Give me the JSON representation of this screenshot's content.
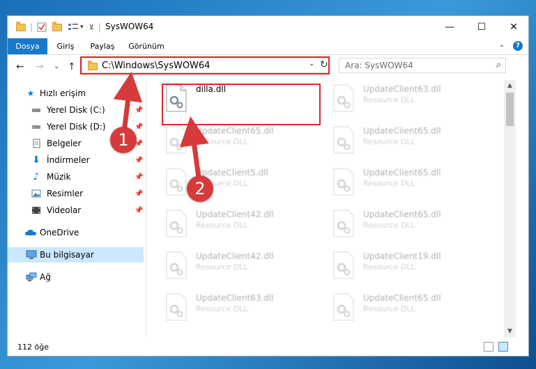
{
  "window": {
    "title": "SysWOW64",
    "minimize_glyph": "—",
    "maximize_glyph": "☐",
    "close_glyph": "✕"
  },
  "ribbon": {
    "tabs": [
      "Dosya",
      "Giriş",
      "Paylaş",
      "Görünüm"
    ],
    "active_tab": "Dosya",
    "help_glyph": "?",
    "accent_color": "#1979ca"
  },
  "address": {
    "path": "C:\\Windows\\SysWOW64",
    "dropdown_glyph": "⌄",
    "refresh_glyph": "↻"
  },
  "search": {
    "placeholder": "Ara: SysWOW64"
  },
  "nav": {
    "back_glyph": "←",
    "forward_glyph": "→",
    "recent_glyph": "⌄",
    "up_glyph": "↑",
    "items": [
      {
        "label": "Hızlı erişim",
        "icon": "star-icon",
        "pinned": false
      },
      {
        "label": "Yerel Disk (C:)",
        "icon": "drive-icon",
        "pinned": true
      },
      {
        "label": "Yerel Disk (D:)",
        "icon": "drive-icon",
        "pinned": true
      },
      {
        "label": "Belgeler",
        "icon": "document-icon",
        "pinned": true
      },
      {
        "label": "İndirmeler",
        "icon": "download-icon",
        "pinned": true
      },
      {
        "label": "Müzik",
        "icon": "music-icon",
        "pinned": true
      },
      {
        "label": "Resimler",
        "icon": "pictures-icon",
        "pinned": true
      },
      {
        "label": "Videolar",
        "icon": "video-icon",
        "pinned": true
      },
      {
        "label": "OneDrive",
        "icon": "cloud-icon",
        "pinned": false
      },
      {
        "label": "Bu bilgisayar",
        "icon": "computer-icon",
        "pinned": false,
        "selected": true
      },
      {
        "label": "Ağ",
        "icon": "network-icon",
        "pinned": false
      }
    ]
  },
  "files": {
    "highlighted": {
      "name": "dilla.dll"
    },
    "left_column": [
      {
        "name": "UpdateClient65.dll",
        "type": "Resource DLL"
      },
      {
        "name": "UpdateClient5.dll",
        "type": "Resource DLL"
      },
      {
        "name": "UpdateClient42.dll",
        "type": "Resource DLL"
      },
      {
        "name": "UpdateClient42.dll",
        "type": "Resource DLL"
      },
      {
        "name": "UpdateClient63.dll",
        "type": "Resource DLL"
      }
    ],
    "right_column": [
      {
        "name": "UpdateClient63.dll",
        "type": "Resource DLL"
      },
      {
        "name": "UpdateClient65.dll",
        "type": "Resource DLL"
      },
      {
        "name": "UpdateClient65.dll",
        "type": "Resource DLL"
      },
      {
        "name": "UpdateClient65.dll",
        "type": "Resource DLL"
      },
      {
        "name": "UpdateClient19.dll",
        "type": "Resource DLL"
      },
      {
        "name": "UpdateClient65.dll",
        "type": "Resource DLL"
      }
    ]
  },
  "status": {
    "item_count": "112 öğe"
  },
  "annotations": {
    "step1": "1",
    "step2": "2",
    "color": "#d62b2b"
  }
}
